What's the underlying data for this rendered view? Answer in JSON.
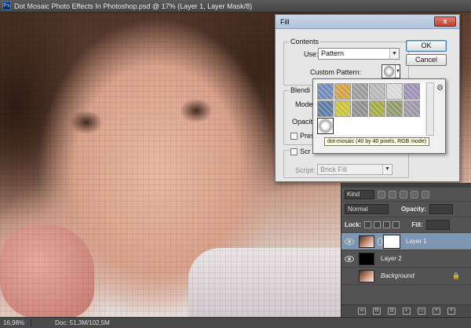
{
  "window": {
    "app_icon": "Ps",
    "title": "Dot Mosaic Photo Effects In Photoshop.psd @ 17% (Layer 1, Layer Mask/8)"
  },
  "status_bar": {
    "zoom": "16,98%",
    "doc_size": "Doc: 51,3M/102,5M"
  },
  "fill_dialog": {
    "title": "Fill",
    "close_label": "x",
    "contents_group": "Contents",
    "use_label": "Use:",
    "use_value": "Pattern",
    "custom_pattern_label": "Custom Pattern:",
    "blending_group": "Blendi",
    "mode_label": "Mode",
    "opacity_label": "Opacity",
    "preserve_label": "Prese",
    "script_checkbox_label": "Scr",
    "script_label": "Script:",
    "script_value": "Brick Fill",
    "ok_label": "OK",
    "cancel_label": "Cancel"
  },
  "pattern_picker": {
    "tooltip": "dot-mosaic (40 by 40 pixels, RGB mode)",
    "patterns": [
      {
        "name": "bubbles",
        "color": "#6f87b9"
      },
      {
        "name": "tie-dye",
        "color": "#d2a040"
      },
      {
        "name": "laid-horizontal",
        "color": "#9a9a9a"
      },
      {
        "name": "fibers",
        "color": "#b5b5b5"
      },
      {
        "name": "gray-granite",
        "color": "#d8d8d8"
      },
      {
        "name": "oak",
        "color": "#9c8fb5"
      },
      {
        "name": "blue-crystal",
        "color": "#5a7aa0"
      },
      {
        "name": "yellow-crepe",
        "color": "#c9c13a"
      },
      {
        "name": "gray-marble",
        "color": "#8e8e8e"
      },
      {
        "name": "green-texture",
        "color": "#a3aa40"
      },
      {
        "name": "wrinkles",
        "color": "#8c9a6a"
      },
      {
        "name": "purple-texture",
        "color": "#9a96a8"
      },
      {
        "name": "dot-mosaic",
        "color": "#ffffff"
      }
    ]
  },
  "layers_panel": {
    "filter_kind": "Kind",
    "blend_mode": "Normal",
    "opacity_label": "Opacity:",
    "lock_label": "Lock:",
    "fill_label": "Fill:",
    "layers": [
      {
        "name": "Layer 1",
        "selected": true
      },
      {
        "name": "Layer 2",
        "selected": false
      },
      {
        "name": "Background",
        "selected": false
      }
    ],
    "footer_icons": [
      "link-icon",
      "fx-icon",
      "mask-icon",
      "adjustment-icon",
      "group-icon",
      "new-layer-icon",
      "trash-icon"
    ]
  },
  "colors": {
    "dialog_bg": "#e6e6e6",
    "panel_bg": "#535353",
    "selected_layer": "#7c95b0",
    "tooltip_bg": "#ffffe1"
  }
}
